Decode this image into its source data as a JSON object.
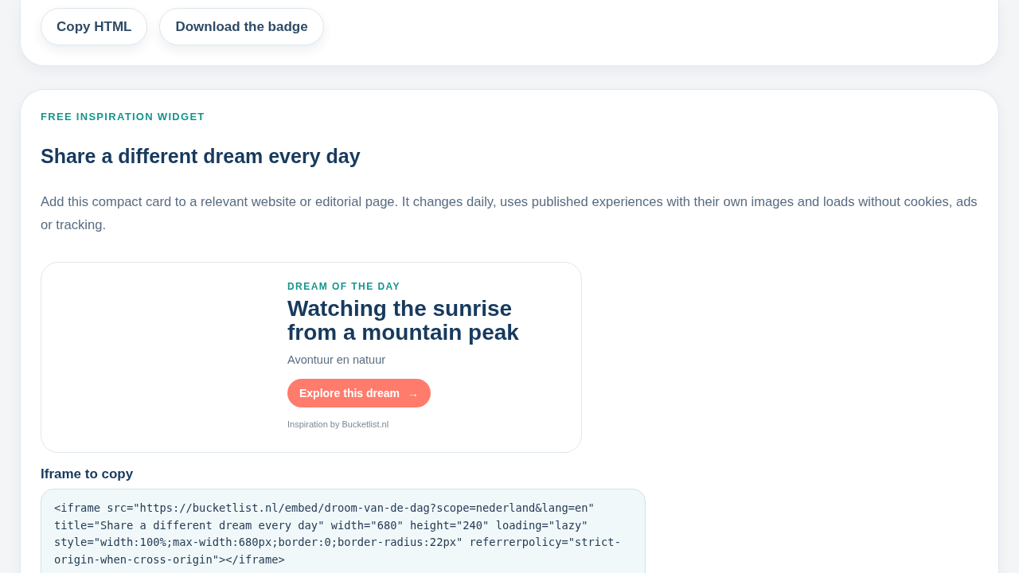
{
  "top_card": {
    "buttons": [
      {
        "label": "Copy HTML"
      },
      {
        "label": "Download the badge"
      }
    ]
  },
  "widget_section": {
    "eyebrow": "FREE INSPIRATION WIDGET",
    "title": "Share a different dream every day",
    "description": "Add this compact card to a relevant website or editorial page. It changes daily, uses published experiences with their own images and loads without cookies, ads or tracking.",
    "preview": {
      "eyebrow": "DREAM OF THE DAY",
      "title": "Watching the sunrise from a mountain peak",
      "category": "Avontuur en natuur",
      "button": {
        "label": "Explore this dream",
        "arrow": "→"
      },
      "credit": "Inspiration by Bucketlist.nl"
    },
    "code_label": "Iframe to copy",
    "code": "<iframe src=\"https://bucketlist.nl/embed/droom-van-de-dag?scope=nederland&lang=en\" title=\"Share a different dream every day\" width=\"680\" height=\"240\" loading=\"lazy\" style=\"width:100%;max-width:680px;border:0;border-radius:22px\" referrerpolicy=\"strict-origin-when-cross-origin\"></iframe>"
  }
}
